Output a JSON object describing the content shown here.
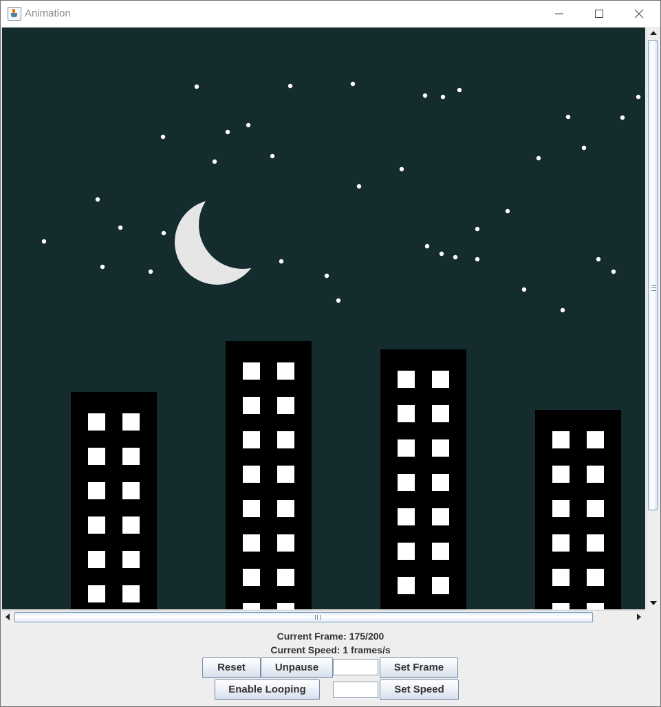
{
  "window": {
    "title": "Animation"
  },
  "status": {
    "current_frame": "Current Frame: 175/200",
    "current_speed": "Current Speed: 1 frames/s"
  },
  "controls": {
    "reset_label": "Reset",
    "unpause_label": "Unpause",
    "set_frame_label": "Set Frame",
    "enable_looping_label": "Enable Looping",
    "set_speed_label": "Set Speed",
    "frame_input_value": "",
    "speed_input_value": ""
  },
  "scene": {
    "sky_color": "#142c2e",
    "moon_color": "#e6e6e6",
    "star_color": "#ffffff",
    "building_color": "#000000",
    "window_color": "#ffffff"
  },
  "icons": [
    "java-app-icon",
    "minimize-icon",
    "maximize-icon",
    "close-icon",
    "scroll-up-icon",
    "scroll-down-icon",
    "scroll-left-icon",
    "scroll-right-icon"
  ]
}
